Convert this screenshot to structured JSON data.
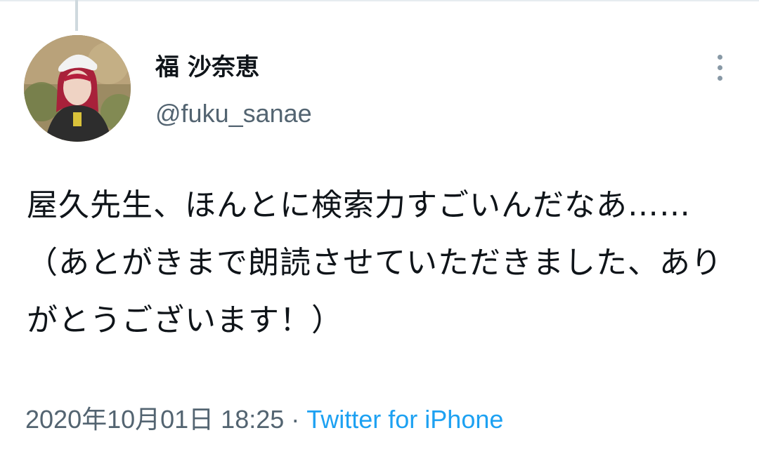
{
  "tweet": {
    "author": {
      "display_name": "福 沙奈恵",
      "handle": "@fuku_sanae",
      "avatar": "profile-photo"
    },
    "body": "屋久先生、ほんとに検索力すごいんだなあ……\n（あとがきまで朗読させていただきました、ありがとうございます！）",
    "timestamp": "2020年10月01日 18:25",
    "separator": "·",
    "source": "Twitter for iPhone",
    "more_icon": "more-vertical-icon"
  },
  "colors": {
    "text_primary": "#0f1419",
    "text_secondary": "#536471",
    "link": "#1da1f2",
    "divider": "#e6ecf0",
    "thread_line": "#cfd9de"
  }
}
